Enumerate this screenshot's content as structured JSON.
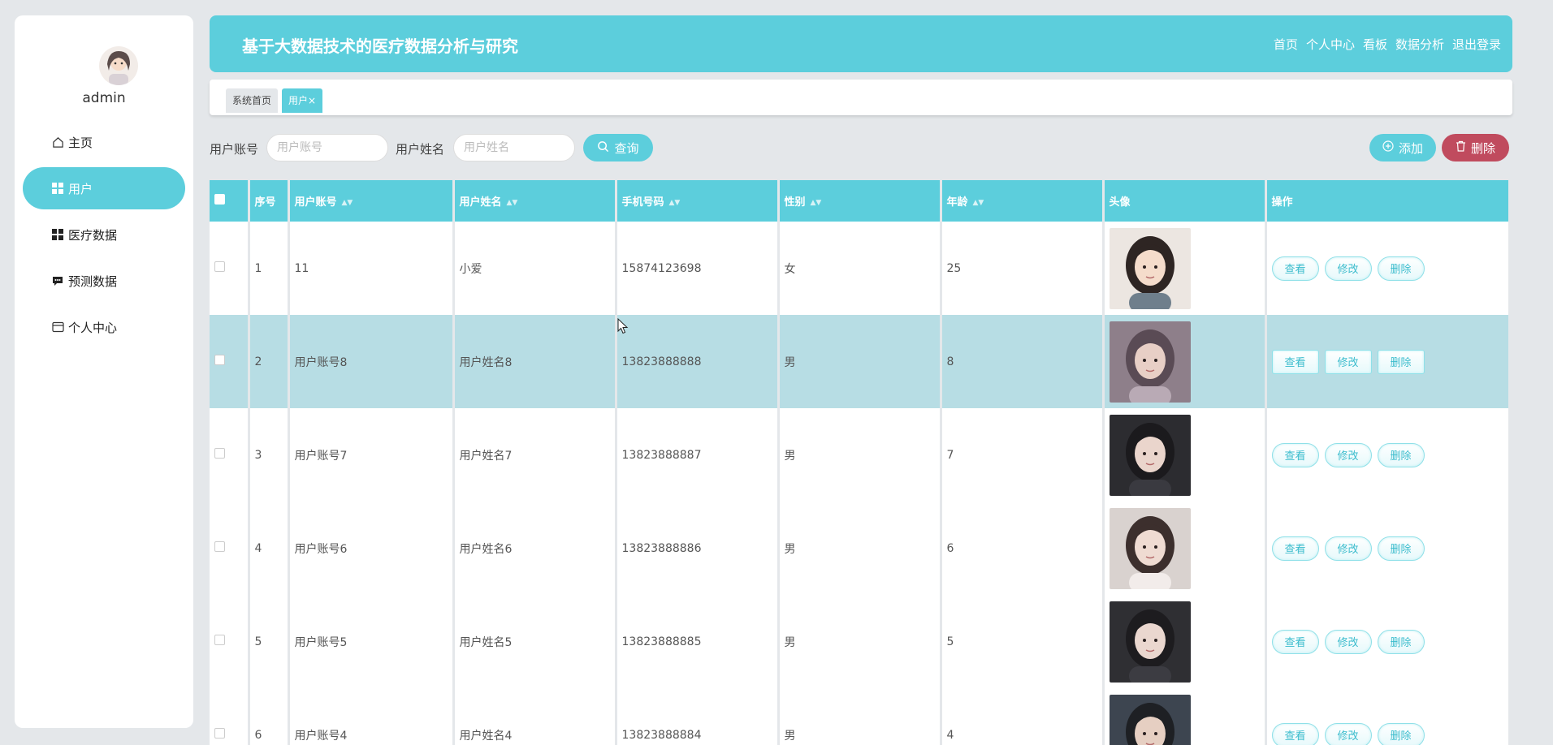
{
  "sidebar": {
    "username": "admin",
    "items": [
      {
        "label": "主页",
        "icon": "home-icon"
      },
      {
        "label": "用户",
        "icon": "grid-icon"
      },
      {
        "label": "医疗数据",
        "icon": "grid-icon"
      },
      {
        "label": "预测数据",
        "icon": "chat-icon"
      },
      {
        "label": "个人中心",
        "icon": "card-icon"
      }
    ],
    "active_index": 1
  },
  "header": {
    "title": "基于大数据技术的医疗数据分析与研究",
    "links": [
      "首页",
      "个人中心",
      "看板",
      "数据分析",
      "退出登录"
    ]
  },
  "tabs": {
    "home": "系统首页",
    "current": "用户",
    "close_glyph": "×"
  },
  "filters": {
    "account_label": "用户账号",
    "account_placeholder": "用户账号",
    "name_label": "用户姓名",
    "name_placeholder": "用户姓名",
    "search_label": "查询",
    "add_label": "添加",
    "delete_label": "删除"
  },
  "table": {
    "headers": [
      "序号",
      "用户账号",
      "用户姓名",
      "手机号码",
      "性别",
      "年龄",
      "头像",
      "操作"
    ],
    "sort_glyph": "▲▼",
    "rows": [
      {
        "no": "1",
        "account": "11",
        "name": "小爱",
        "phone": "15874123698",
        "gender": "女",
        "age": "25"
      },
      {
        "no": "2",
        "account": "用户账号8",
        "name": "用户姓名8",
        "phone": "13823888888",
        "gender": "男",
        "age": "8"
      },
      {
        "no": "3",
        "account": "用户账号7",
        "name": "用户姓名7",
        "phone": "13823888887",
        "gender": "男",
        "age": "7"
      },
      {
        "no": "4",
        "account": "用户账号6",
        "name": "用户姓名6",
        "phone": "13823888886",
        "gender": "男",
        "age": "6"
      },
      {
        "no": "5",
        "account": "用户账号5",
        "name": "用户姓名5",
        "phone": "13823888885",
        "gender": "男",
        "age": "5"
      },
      {
        "no": "6",
        "account": "用户账号4",
        "name": "用户姓名4",
        "phone": "13823888884",
        "gender": "男",
        "age": "4"
      }
    ],
    "ops": {
      "view": "查看",
      "edit": "修改",
      "delete": "删除"
    },
    "highlighted_row": 1
  },
  "colors": {
    "accent": "#5ccedc",
    "danger": "#c04b5e",
    "row_highlight": "#b7dde4"
  }
}
